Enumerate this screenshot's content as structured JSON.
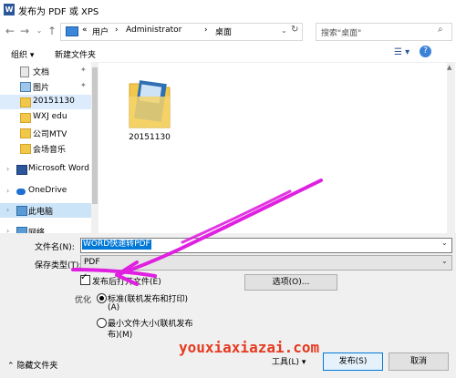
{
  "window": {
    "title": "发布为 PDF 或 XPS",
    "app_icon": "W"
  },
  "address": {
    "prefix": "«",
    "crumbs": [
      "用户",
      "Administrator",
      "桌面"
    ],
    "separator": "›"
  },
  "search": {
    "placeholder": "搜索\"桌面\""
  },
  "toolbar": {
    "organize": "组织 ▾",
    "new_folder": "新建文件夹",
    "view": "☰ ▾",
    "help": "?"
  },
  "sidebar": {
    "items": [
      {
        "label": "文档",
        "pinned": true
      },
      {
        "label": "图片",
        "pinned": true
      },
      {
        "label": "20151130",
        "pinned": false
      },
      {
        "label": "WXJ edu",
        "pinned": false
      },
      {
        "label": "公司MTV",
        "pinned": false
      },
      {
        "label": "会场音乐",
        "pinned": false
      },
      {
        "label": "Microsoft Word",
        "pinned": false
      },
      {
        "label": "OneDrive",
        "pinned": false
      },
      {
        "label": "此电脑",
        "pinned": false
      },
      {
        "label": "网络",
        "pinned": false
      }
    ]
  },
  "files": [
    {
      "name": "20151130"
    }
  ],
  "form": {
    "filename_label": "文件名(N):",
    "filename_value": "WORD快速转PDF",
    "type_label": "保存类型(T):",
    "type_value": "PDF",
    "open_after_label": "发布后打开文件(E)",
    "options_button": "选项(O)...",
    "optimize_label": "优化",
    "std_line1": "标准(联机发布和打印)",
    "std_line2": "(A)",
    "min_line1": "最小文件大小(联机发布",
    "min_line2": "布)(M)"
  },
  "footer": {
    "hide_folders": "隐藏文件夹",
    "tools": "工具(L)",
    "publish": "发布(S)",
    "cancel": "取消"
  },
  "watermark": "youxiaxiazai.com",
  "colors": {
    "accent": "#0078d7",
    "annotation": "#e020e0",
    "watermark": "#e53a1f"
  }
}
